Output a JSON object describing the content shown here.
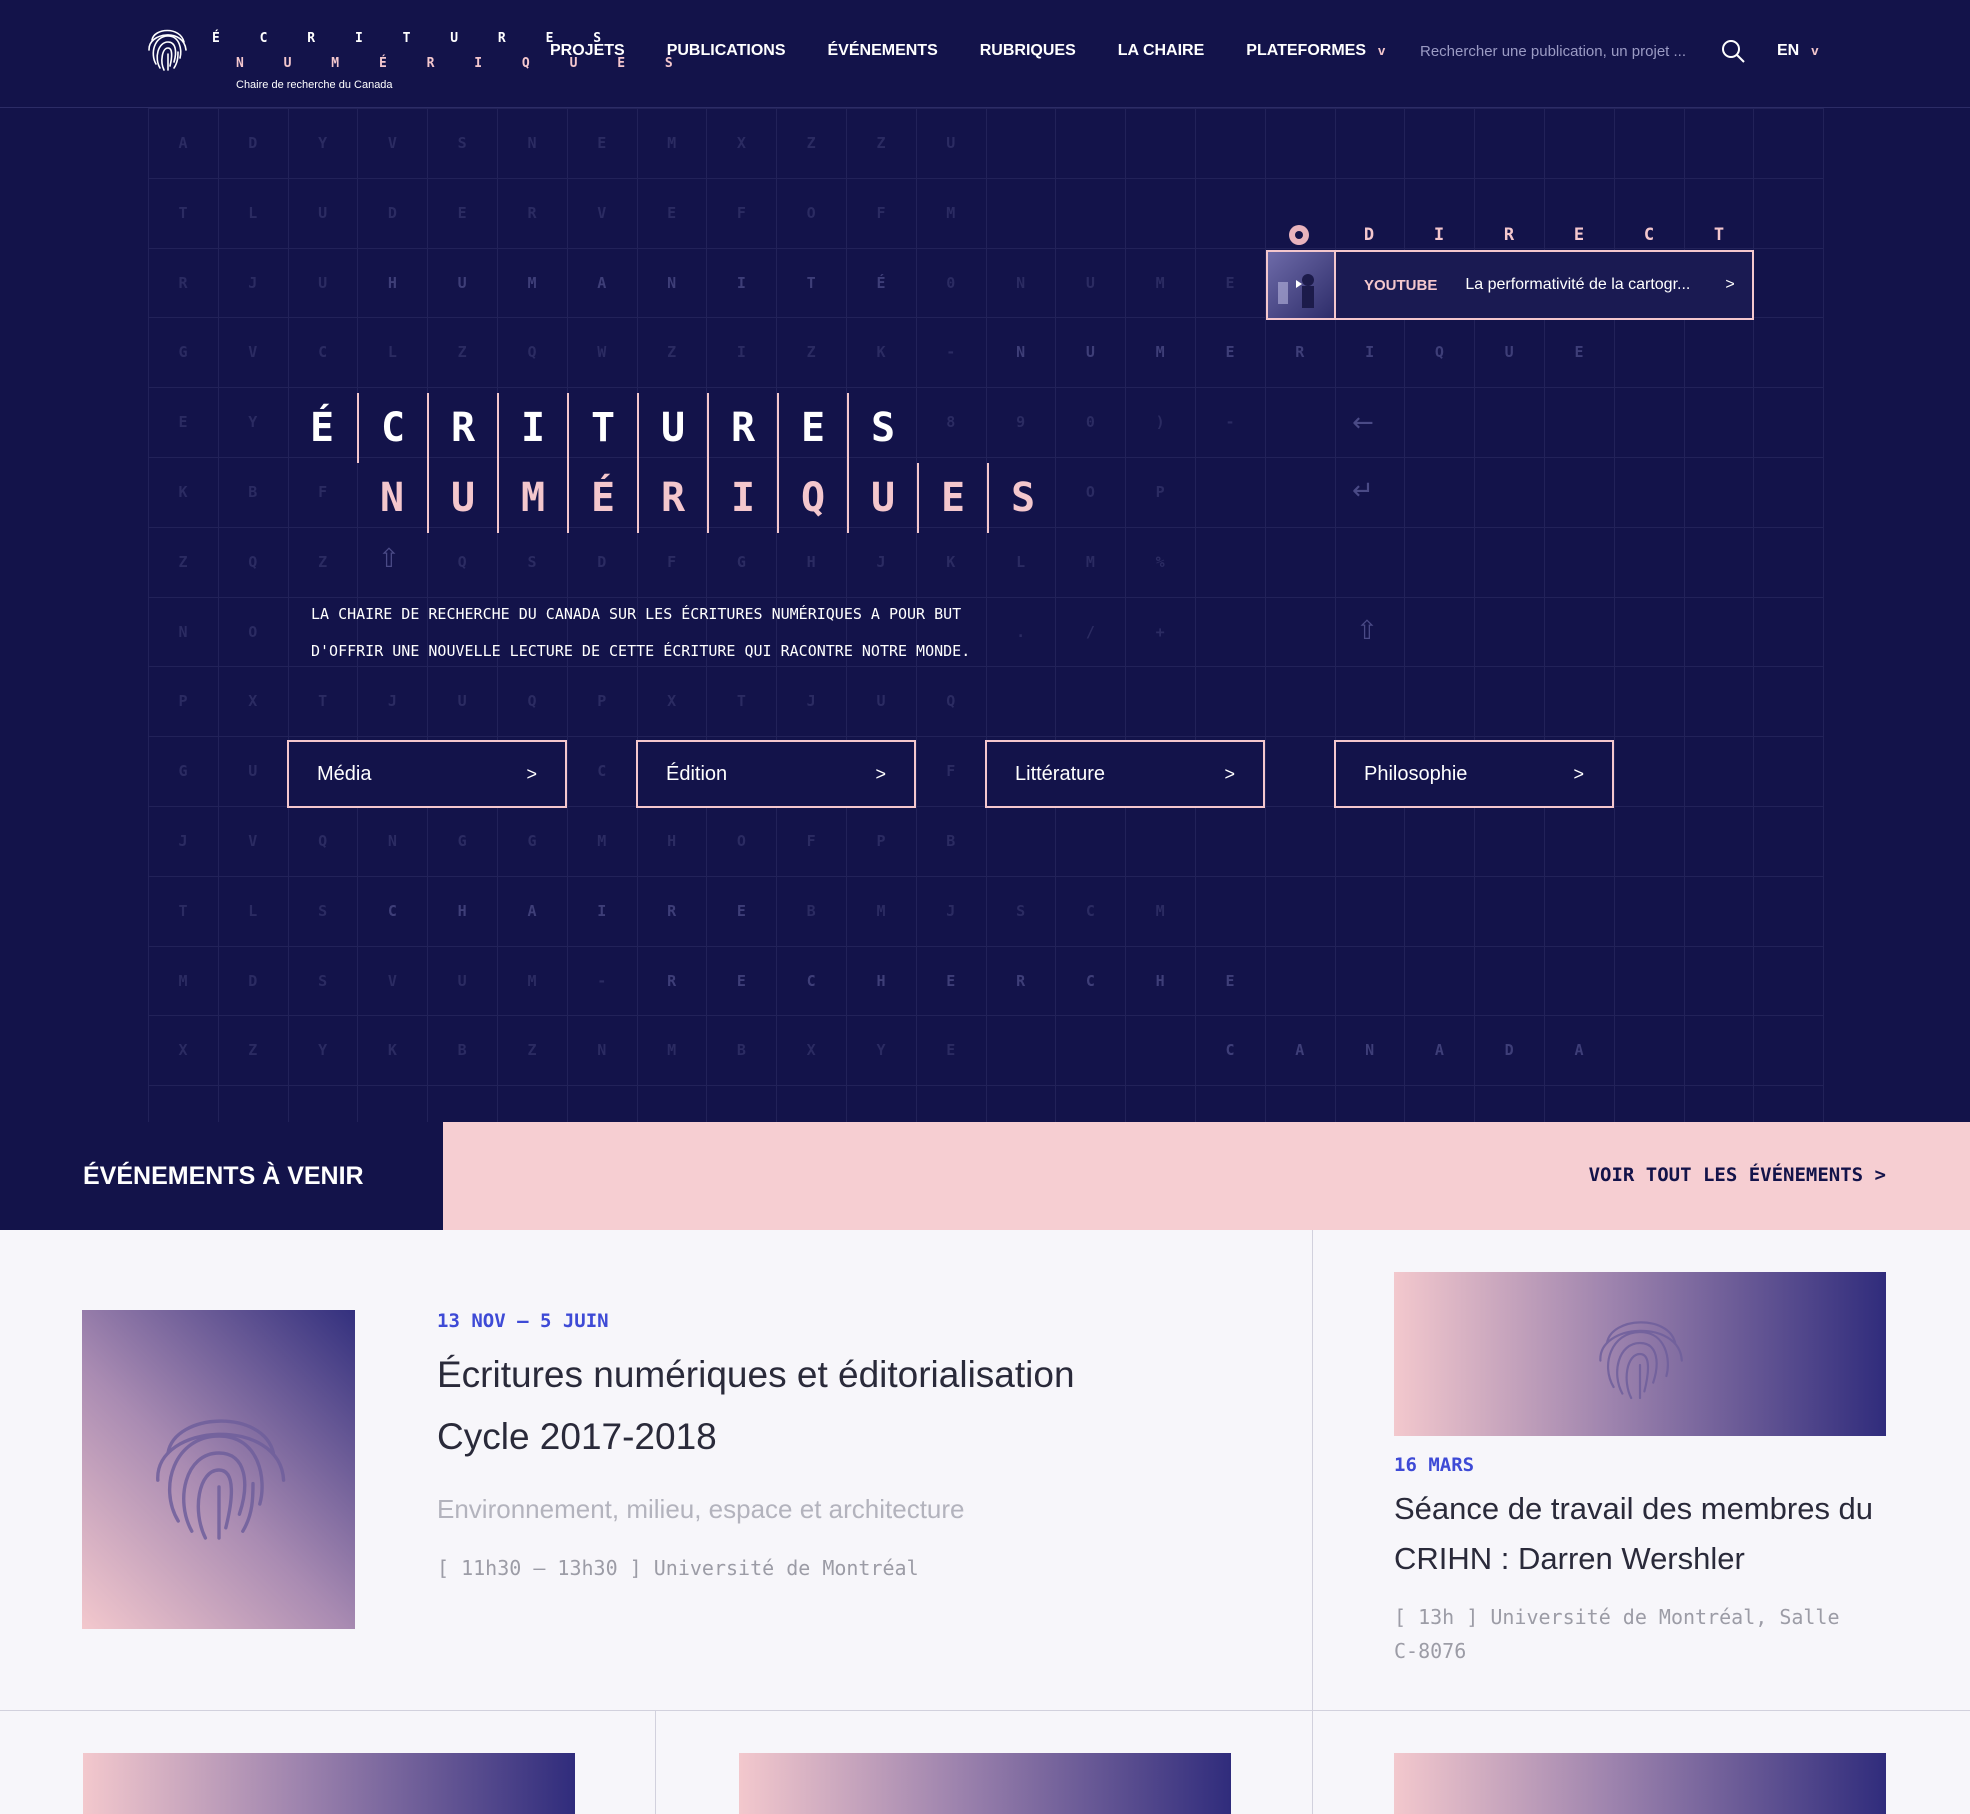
{
  "header": {
    "logo": {
      "line1": "É C R I T U R E S",
      "line2": "N U M É R I Q U E S",
      "subtitle": "Chaire de recherche du Canada"
    },
    "nav": [
      {
        "label": "PROJETS"
      },
      {
        "label": "PUBLICATIONS"
      },
      {
        "label": "ÉVÉNEMENTS"
      },
      {
        "label": "RUBRIQUES"
      },
      {
        "label": "LA CHAIRE"
      },
      {
        "label": "PLATEFORMES",
        "chevron": "v"
      }
    ],
    "search": {
      "placeholder": "Rechercher une publication, un projet ..."
    },
    "lang": {
      "label": "EN",
      "chevron": "v"
    }
  },
  "hero": {
    "title_line1": [
      "É",
      "C",
      "R",
      "I",
      "T",
      "U",
      "R",
      "E",
      "S"
    ],
    "title_line2": [
      "N",
      "U",
      "M",
      "É",
      "R",
      "I",
      "Q",
      "U",
      "E",
      "S"
    ],
    "description_line1": "LA CHAIRE DE RECHERCHE DU CANADA SUR LES ÉCRITURES NUMÉRIQUES A POUR BUT",
    "description_line2": "D'OFFRIR UNE NOUVELLE LECTURE DE CETTE ÉCRITURE QUI RACONTRE NOTRE MONDE.",
    "categories": [
      {
        "label": "Média",
        "arrow": ">"
      },
      {
        "label": "Édition",
        "arrow": ">"
      },
      {
        "label": "Littérature",
        "arrow": ">"
      },
      {
        "label": "Philosophie",
        "arrow": ">"
      }
    ],
    "direct": {
      "letters": [
        "D",
        "I",
        "R",
        "E",
        "C",
        "T"
      ],
      "source": "YOUTUBE",
      "title": "La performativité de la cartogr...",
      "arrow": ">"
    },
    "background_rows": [
      [
        "A",
        "D",
        "Y",
        "V",
        "S",
        "N",
        "E",
        "M",
        "X",
        "Z",
        "Z",
        "U"
      ],
      [
        "T",
        "L",
        "U",
        "D",
        "E",
        "R",
        "V",
        "E",
        "F",
        "O",
        "F",
        "M"
      ],
      [
        "R",
        "J",
        "U",
        "H",
        "U",
        "M",
        "A",
        "N",
        "I",
        "T",
        "É",
        "0",
        "N",
        "U",
        "M",
        "E"
      ],
      [
        "G",
        "V",
        "C",
        "L",
        "Z",
        "Q",
        "W",
        "Z",
        "I",
        "Z",
        "K",
        "-",
        "N",
        "U",
        "M",
        "E",
        "R",
        "I",
        "Q",
        "U",
        "E"
      ],
      [
        "E",
        "Y",
        "",
        "",
        "",
        "",
        "",
        "",
        "",
        "",
        "",
        "8",
        "9",
        "0",
        ")",
        "-"
      ],
      [
        "K",
        "B",
        "F",
        "",
        "",
        "",
        "",
        "",
        "",
        "",
        "",
        "",
        "",
        "O",
        "P"
      ],
      [
        "Z",
        "Q",
        "Z",
        "",
        "Q",
        "S",
        "D",
        "F",
        "G",
        "H",
        "J",
        "K",
        "L",
        "M",
        "%"
      ],
      [
        "N",
        "O",
        "",
        "",
        "",
        "",
        "",
        "",
        "",
        "",
        "",
        "",
        ".",
        "/",
        "+"
      ],
      [
        "P",
        "X",
        "T",
        "J",
        "U",
        "Q",
        "P",
        "X",
        "T",
        "J",
        "U",
        "Q"
      ],
      [
        "G",
        "U",
        "",
        "",
        "",
        "",
        "C",
        "",
        "",
        "",
        "",
        "F"
      ],
      [
        "J",
        "V",
        "Q",
        "N",
        "G",
        "G",
        "M",
        "H",
        "O",
        "F",
        "P",
        "B"
      ],
      [
        "T",
        "L",
        "S",
        "C",
        "H",
        "A",
        "I",
        "R",
        "E",
        "B",
        "M",
        "J",
        "S",
        "C",
        "M"
      ],
      [
        "M",
        "D",
        "S",
        "V",
        "U",
        "M",
        "-",
        "R",
        "E",
        "C",
        "H",
        "E",
        "R",
        "C",
        "H",
        "E"
      ],
      [
        "X",
        "Z",
        "Y",
        "K",
        "B",
        "Z",
        "N",
        "M",
        "B",
        "X",
        "Y",
        "E",
        "",
        "",
        "",
        "C",
        "A",
        "N",
        "A",
        "D",
        "A"
      ]
    ]
  },
  "events": {
    "heading": "ÉVÉNEMENTS À VENIR",
    "see_all": "VOIR TOUT LES ÉVÉNEMENTS >",
    "featured": {
      "date": "13 NOV – 5 JUIN",
      "title_line1": "Écritures numériques et éditorialisation",
      "title_line2": "Cycle 2017-2018",
      "subtitle": "Environnement, milieu, espace et architecture",
      "meta": "[ 11h30 – 13h30 ] Université de Montréal"
    },
    "side": {
      "date": "16 MARS",
      "title_line1": "Séance de travail des membres du",
      "title_line2": "CRIHN : Darren Wershler",
      "meta_line1": "[ 13h ] Université de Montréal, Salle",
      "meta_line2": "C-8076"
    }
  },
  "colors": {
    "navy": "#13134a",
    "pink": "#f4c7cd",
    "accent_blue": "#3e4ad6",
    "events_bar": "#f6ced2"
  }
}
